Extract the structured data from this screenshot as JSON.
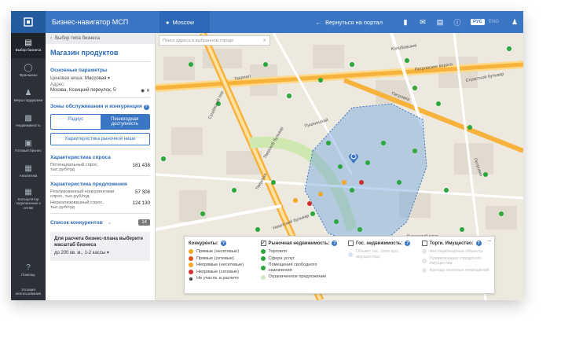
{
  "header": {
    "app_title": "Бизнес-навигатор МСП",
    "city": "Moscow",
    "back_label": "Вернуться на портал",
    "lang_active": "РУС",
    "lang_inactive": "ENG"
  },
  "leftnav": {
    "items": [
      {
        "label": "Выбор бизнеса",
        "icon": "briefcase-icon"
      },
      {
        "label": "Франшизы",
        "icon": "franchise-icon"
      },
      {
        "label": "Меры поддержки",
        "icon": "people-icon"
      },
      {
        "label": "Недвижимость",
        "icon": "building-icon"
      },
      {
        "label": "Готовый бизнес",
        "icon": "shop-icon"
      },
      {
        "label": "Аналитика",
        "icon": "chart-icon"
      },
      {
        "label": "Калькулятор подключения к сетям",
        "icon": "calculator-icon"
      }
    ],
    "help_label": "Помощь",
    "terms_label": "Условия использования"
  },
  "panel": {
    "breadcrumb": "Выбор типа бизнеса",
    "title": "Магазин продуктов",
    "basic_params_heading": "Основные параметры",
    "price_label": "Ценовая ниша:",
    "price_value": "Массовая",
    "address_label": "Адрес:",
    "address_value": "Москва, Козицкий переулок, 5",
    "zones_heading": "Зоны обслуживания и конкуренция",
    "zone_radius": "Радиус",
    "zone_walk": "Пешеходная доступность",
    "market_button": "Характеристика рыночной ниши",
    "demand_heading": "Характеристика спроса",
    "demand_label": "Потенциальный спрос, тыс.руб/год",
    "demand_value": "181 438",
    "supply_heading": "Характеристика предложения",
    "supply_realized_label": "Реализованный конкурентами спрос, тыс.руб/год",
    "supply_realized_value": "57 308",
    "supply_unrealized_label": "Нереализованный спрос, тыс.руб/год",
    "supply_unrealized_value": "124 130",
    "competitors_label": "Список конкурентов",
    "competitors_count": "14",
    "plan_text": "Для расчета бизнес-плана выберите масштаб бизнеса",
    "plan_select": "до 200 кв. м., 1-2 кассы"
  },
  "map": {
    "search_placeholder": "Поиск адреса в выбранном городе",
    "street_labels": [
      "Колобовский",
      "Петровские ворота",
      "Страстной бульвар",
      "Петровка",
      "Пушкинский",
      "Тверской бульвар",
      "Сущёвский пер",
      "Твериал",
      "Тверская",
      "Никитский бульвар",
      "Кузнецкий мост",
      "Петровка"
    ],
    "legend": {
      "competitors_heading": "Конкуренты:",
      "competitors_items": [
        {
          "label": "Прямые (несетевые)",
          "color": "#f5a623"
        },
        {
          "label": "Прямые (сетевые)",
          "color": "#e0531f"
        },
        {
          "label": "Непрямые (несетевые)",
          "color": "#f5a623"
        },
        {
          "label": "Непрямые (сетевые)",
          "color": "#d0312d"
        },
        {
          "label": "Не участв. в расчете",
          "color": "#444444"
        }
      ],
      "commercial_heading": "Рыночная недвижимость:",
      "commercial_checked": true,
      "commercial_items": [
        {
          "label": "Торговля",
          "color": "#2aa83c"
        },
        {
          "label": "Сфера услуг",
          "color": "#2aa83c"
        },
        {
          "label": "Помещения свободного назначения",
          "color": "#2aa83c"
        },
        {
          "label": "Ограниченное предложение",
          "color": "#cfe8c6"
        }
      ],
      "state_heading": "Гос. недвижимость:",
      "state_items": [
        {
          "label": "Объект гос. (или муз. имущества)"
        }
      ],
      "auction_heading": "Торги. Имущество:",
      "auction_items": [
        {
          "label": "Нестационарные объекты"
        },
        {
          "label": "Приватизация городского имущества"
        },
        {
          "label": "Аренда нежилых помещений"
        }
      ]
    },
    "colors": {
      "zone_fill": "#6fa3e0",
      "major_road": "#f6b23b",
      "green": "#2aa83c"
    }
  }
}
